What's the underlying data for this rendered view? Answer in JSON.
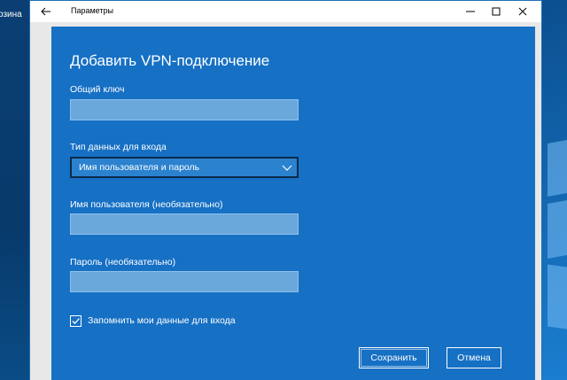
{
  "desktop": {
    "icon_label": "рзина"
  },
  "window": {
    "title": "Параметры",
    "icons": {
      "back": "back-arrow-icon",
      "minimize": "minimize-icon",
      "maximize": "maximize-icon",
      "close": "close-icon"
    }
  },
  "dialog": {
    "title": "Добавить VPN-подключение",
    "pre_shared_key": {
      "label": "Общий ключ",
      "value": ""
    },
    "sign_in_type": {
      "label": "Тип данных для входа",
      "value": "Имя пользователя и пароль",
      "icon": "chevron-down-icon"
    },
    "username": {
      "label": "Имя пользователя (необязательно)",
      "value": ""
    },
    "password": {
      "label": "Пароль (необязательно)",
      "value": ""
    },
    "remember": {
      "label": "Запомнить мои данные для входа",
      "checked": true
    },
    "save_label": "Сохранить",
    "cancel_label": "Отмена"
  },
  "colors": {
    "dialog_bg": "#1670c4",
    "input_bg": "#6aa8dc",
    "select_bg": "#2b82cf"
  }
}
